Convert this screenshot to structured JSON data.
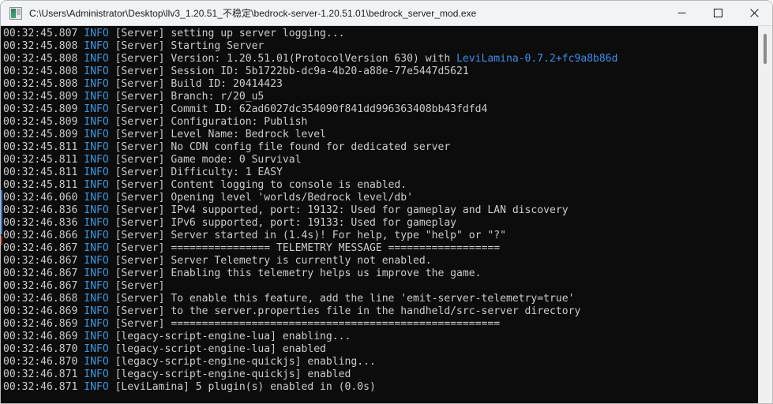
{
  "window": {
    "title": "C:\\Users\\Administrator\\Desktop\\llv3_1.20.51_不稳定\\bedrock-server-1.20.51.01\\bedrock_server_mod.exe",
    "icon": "console-app-icon",
    "controls": {
      "minimize_label": "Minimize",
      "maximize_label": "Maximize",
      "close_label": "Close"
    }
  },
  "console": {
    "background_color": "#0c0c0c",
    "text_color": "#cccccc",
    "info_color": "#3a96dd",
    "accent_color": "#3b8eea",
    "lines": [
      {
        "time": "00:32:45.807",
        "level": "INFO",
        "tag": "[Server]",
        "msg": "setting up server logging..."
      },
      {
        "time": "00:32:45.808",
        "level": "INFO",
        "tag": "[Server]",
        "msg": "Starting Server"
      },
      {
        "time": "00:32:45.808",
        "level": "INFO",
        "tag": "[Server]",
        "msg": "Version: 1.20.51.01(ProtocolVersion 630) with ",
        "accent": "LeviLamina-0.7.2+fc9a8b86d"
      },
      {
        "time": "00:32:45.808",
        "level": "INFO",
        "tag": "[Server]",
        "msg": "Session ID: 5b1722bb-dc9a-4b20-a88e-77e5447d5621"
      },
      {
        "time": "00:32:45.808",
        "level": "INFO",
        "tag": "[Server]",
        "msg": "Build ID: 20414423"
      },
      {
        "time": "00:32:45.809",
        "level": "INFO",
        "tag": "[Server]",
        "msg": "Branch: r/20_u5"
      },
      {
        "time": "00:32:45.809",
        "level": "INFO",
        "tag": "[Server]",
        "msg": "Commit ID: 62ad6027dc354090f841dd996363408bb43fdfd4"
      },
      {
        "time": "00:32:45.809",
        "level": "INFO",
        "tag": "[Server]",
        "msg": "Configuration: Publish"
      },
      {
        "time": "00:32:45.809",
        "level": "INFO",
        "tag": "[Server]",
        "msg": "Level Name: Bedrock level"
      },
      {
        "time": "00:32:45.811",
        "level": "INFO",
        "tag": "[Server]",
        "msg": "No CDN config file found for dedicated server"
      },
      {
        "time": "00:32:45.811",
        "level": "INFO",
        "tag": "[Server]",
        "msg": "Game mode: 0 Survival"
      },
      {
        "time": "00:32:45.811",
        "level": "INFO",
        "tag": "[Server]",
        "msg": "Difficulty: 1 EASY"
      },
      {
        "time": "00:32:45.811",
        "level": "INFO",
        "tag": "[Server]",
        "msg": "Content logging to console is enabled."
      },
      {
        "time": "00:32:46.060",
        "level": "INFO",
        "tag": "[Server]",
        "msg": "Opening level 'worlds/Bedrock level/db'"
      },
      {
        "time": "00:32:46.836",
        "level": "INFO",
        "tag": "[Server]",
        "msg": "IPv4 supported, port: 19132: Used for gameplay and LAN discovery"
      },
      {
        "time": "00:32:46.836",
        "level": "INFO",
        "tag": "[Server]",
        "msg": "IPv6 supported, port: 19133: Used for gameplay"
      },
      {
        "time": "00:32:46.866",
        "level": "INFO",
        "tag": "[Server]",
        "msg": "Server started in (1.4s)! For help, type \"help\" or \"?\""
      },
      {
        "time": "00:32:46.867",
        "level": "INFO",
        "tag": "[Server]",
        "msg": "================ TELEMETRY MESSAGE =================="
      },
      {
        "time": "00:32:46.867",
        "level": "INFO",
        "tag": "[Server]",
        "msg": "Server Telemetry is currently not enabled."
      },
      {
        "time": "00:32:46.867",
        "level": "INFO",
        "tag": "[Server]",
        "msg": "Enabling this telemetry helps us improve the game."
      },
      {
        "time": "00:32:46.867",
        "level": "INFO",
        "tag": "[Server]",
        "msg": ""
      },
      {
        "time": "00:32:46.868",
        "level": "INFO",
        "tag": "[Server]",
        "msg": "To enable this feature, add the line 'emit-server-telemetry=true'"
      },
      {
        "time": "00:32:46.869",
        "level": "INFO",
        "tag": "[Server]",
        "msg": "to the server.properties file in the handheld/src-server directory"
      },
      {
        "time": "00:32:46.869",
        "level": "INFO",
        "tag": "[Server]",
        "msg": "====================================================="
      },
      {
        "time": "00:32:46.869",
        "level": "INFO",
        "tag": "[legacy-script-engine-lua]",
        "msg": "enabling..."
      },
      {
        "time": "00:32:46.870",
        "level": "INFO",
        "tag": "[legacy-script-engine-lua]",
        "msg": "enabled"
      },
      {
        "time": "00:32:46.870",
        "level": "INFO",
        "tag": "[legacy-script-engine-quickjs]",
        "msg": "enabling..."
      },
      {
        "time": "00:32:46.871",
        "level": "INFO",
        "tag": "[legacy-script-engine-quickjs]",
        "msg": "enabled"
      },
      {
        "time": "00:32:46.871",
        "level": "INFO",
        "tag": "[LeviLamina]",
        "msg": "5 plugin(s) enabled in (0.0s)"
      }
    ]
  },
  "scrollbar": {
    "thumb_position_pct": 2,
    "thumb_size_pct": 8
  }
}
